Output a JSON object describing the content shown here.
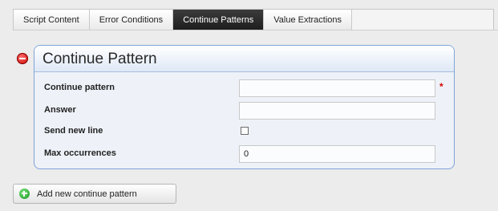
{
  "tabs": [
    {
      "label": "Script Content",
      "active": false
    },
    {
      "label": "Error Conditions",
      "active": false
    },
    {
      "label": "Continue Patterns",
      "active": true
    },
    {
      "label": "Value Extractions",
      "active": false
    }
  ],
  "panel": {
    "title": "Continue Pattern",
    "fields": {
      "continue_pattern": {
        "label": "Continue pattern",
        "value": "",
        "required_marker": "*"
      },
      "answer": {
        "label": "Answer",
        "value": ""
      },
      "send_new_line": {
        "label": "Send new line",
        "checked": false
      },
      "max_occurrences": {
        "label": "Max occurrences",
        "value": "0"
      }
    }
  },
  "add_button": {
    "label": "Add new continue pattern"
  },
  "icons": {
    "remove": "remove-circle-icon",
    "add": "add-circle-icon"
  },
  "colors": {
    "active_tab": "#2a2a2a",
    "panel_border": "#7fa4d9",
    "required": "#d60000"
  }
}
